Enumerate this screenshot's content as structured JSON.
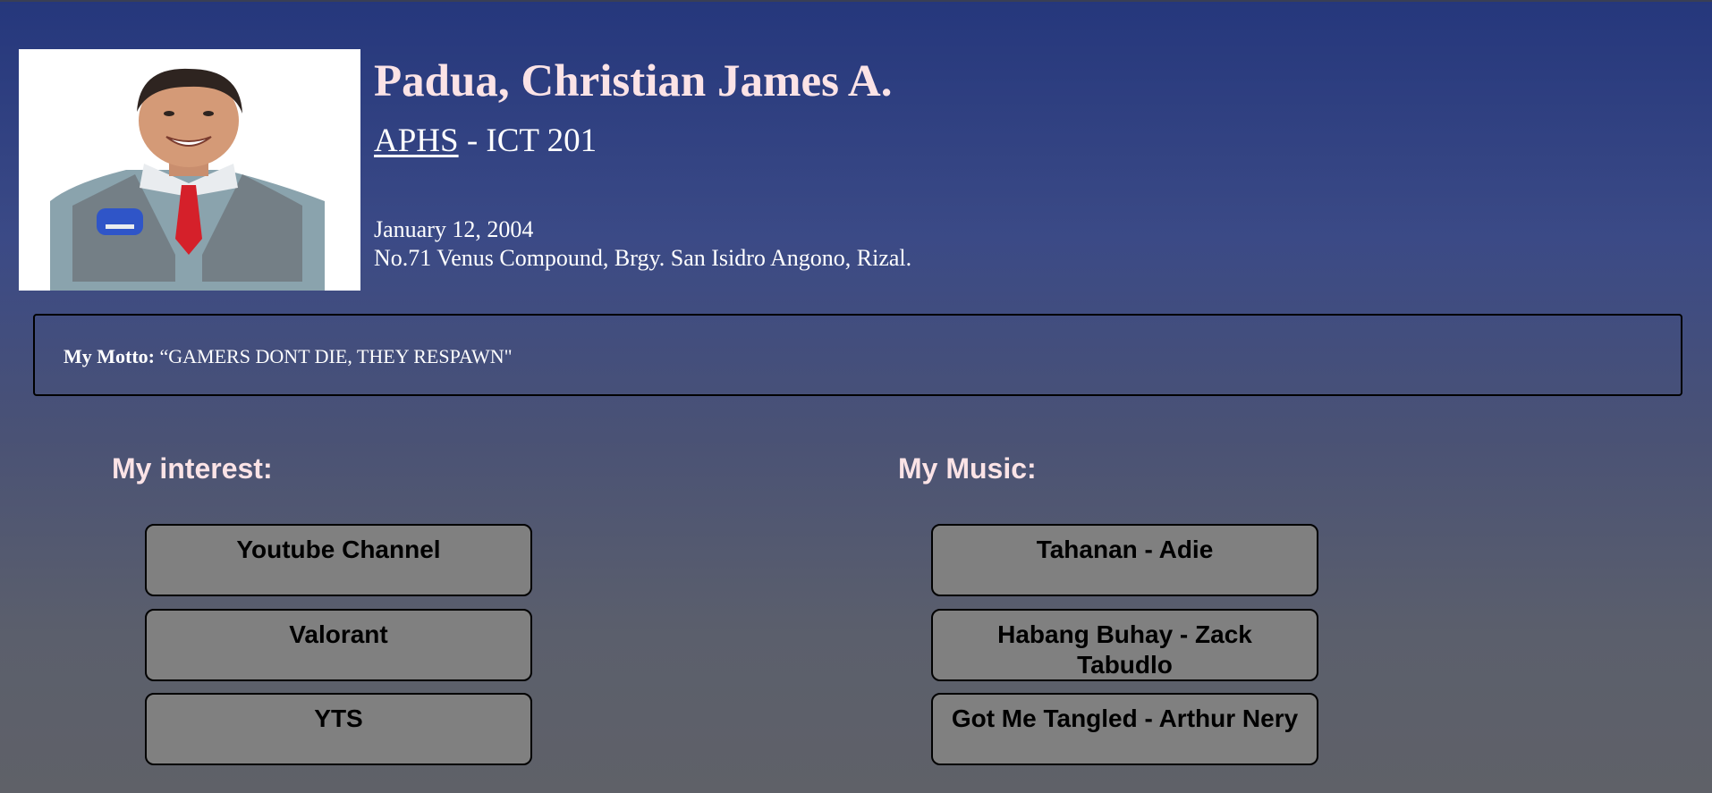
{
  "profile": {
    "name": "Padua, Christian James A.",
    "school": "APHS",
    "section": " - ICT 201",
    "birthdate": "January 12, 2004",
    "address": "No.71 Venus Compound, Brgy. San Isidro Angono, Rizal."
  },
  "motto": {
    "label": "My Motto:",
    "text": " “GAMERS DONT DIE, THEY RESPAWN\""
  },
  "interests": {
    "title": "My interest:",
    "items": [
      "Youtube Channel",
      "Valorant",
      "YTS"
    ]
  },
  "music": {
    "title": "My Music:",
    "items": [
      "Tahanan - Adie",
      "Habang Buhay - Zack Tabudlo",
      "Got Me Tangled - Arthur Nery"
    ]
  },
  "colors": {
    "background_top": "#25377c",
    "background_bottom": "#5f6168",
    "heading": "#fbe3e6",
    "card": "#808080"
  }
}
